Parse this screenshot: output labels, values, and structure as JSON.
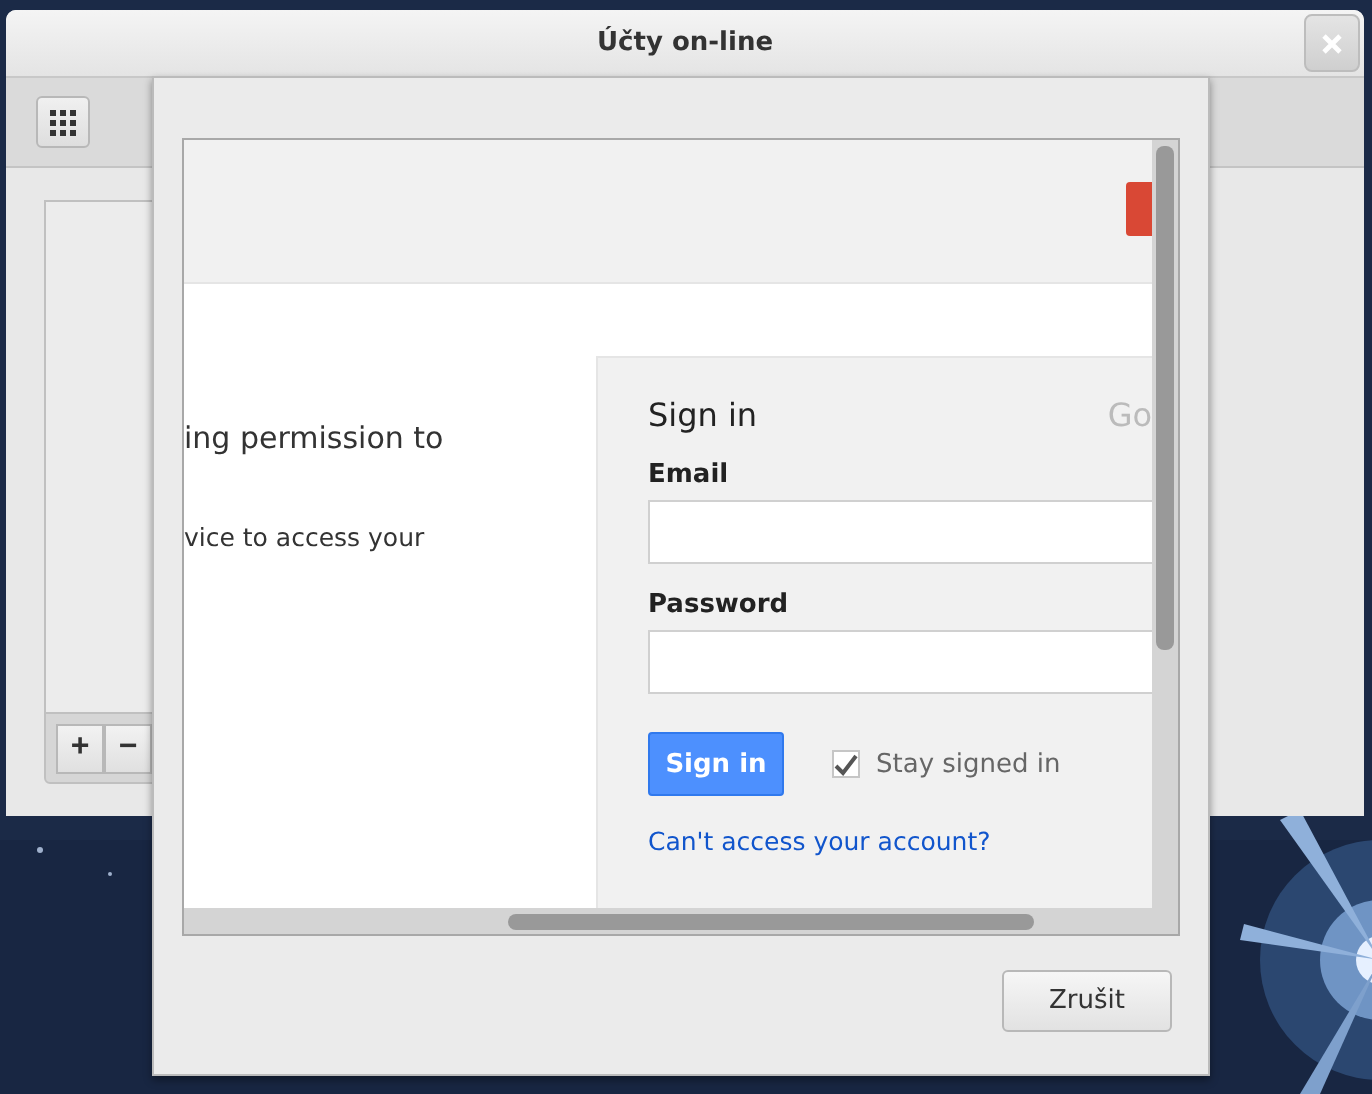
{
  "main_window": {
    "title": "Účty on-line",
    "list_buttons": [
      "+",
      "−"
    ]
  },
  "dialog": {
    "web_page": {
      "intro_lines": [
        "ing permission to",
        "vice to access your"
      ],
      "sign_in": {
        "heading": "Sign in",
        "logo": "Go",
        "fields": [
          {
            "label": "Email"
          },
          {
            "label": "Password"
          }
        ],
        "button": "Sign in",
        "stay_signed_in": {
          "label": "Stay signed in",
          "checked": true
        },
        "help_link": "Can't access your account?"
      }
    },
    "buttons": [
      "Zrušit"
    ]
  }
}
